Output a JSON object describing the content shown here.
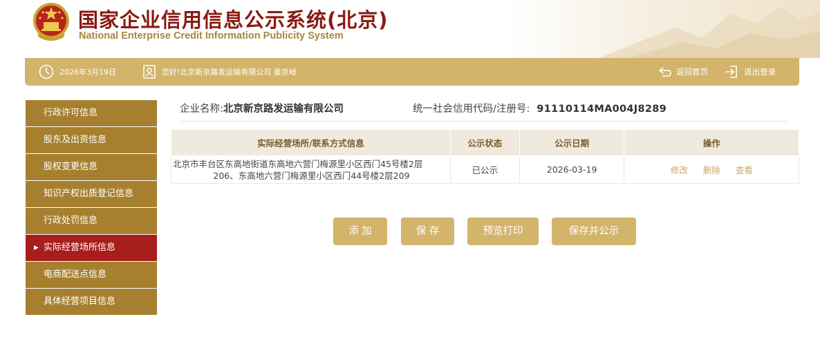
{
  "header": {
    "title_cn": "国家企业信用信息公示系统(北京)",
    "title_en": "National Enterprise Credit Information Publicity System"
  },
  "topbar": {
    "date": "2026年3月19日",
    "greeting": "您好!北京新京路发运输有限公司 姜京岐",
    "back_home": "返回首页",
    "logout": "退出登录"
  },
  "sidebar": {
    "items": [
      {
        "label": "行政许可信息"
      },
      {
        "label": "股东及出资信息"
      },
      {
        "label": "股权变更信息"
      },
      {
        "label": "知识产权出质登记信息"
      },
      {
        "label": "行政处罚信息"
      },
      {
        "label": "实际经营场所信息",
        "active": true
      },
      {
        "label": "电商配送点信息"
      },
      {
        "label": "具体经营项目信息"
      }
    ]
  },
  "company": {
    "name_label": "企业名称:",
    "name": "北京新京路发运输有限公司",
    "credit_label": "统一社会信用代码/注册号:",
    "credit_code": "91110114MA004J8289"
  },
  "table": {
    "headers": [
      "实际经营场所/联系方式信息",
      "公示状态",
      "公示日期",
      "操作"
    ],
    "rows": [
      {
        "address_line1": "北京市丰台区东高地街道东高地六营门梅源里小区西门45号楼2层",
        "address_line2": "206、东高地六营门梅源里小区西门44号楼2层209",
        "status": "已公示",
        "date": "2026-03-19",
        "actions": {
          "edit": "修改",
          "delete": "删除",
          "view": "查看"
        }
      }
    ]
  },
  "buttons": {
    "add": "添 加",
    "save": "保 存",
    "preview": "预览打印",
    "save_publish": "保存并公示"
  },
  "colors": {
    "brand_gold": "#d4b36a",
    "sidebar_bg": "#a7802f",
    "sidebar_active": "#a81e1c",
    "title_red": "#8b1a12"
  }
}
